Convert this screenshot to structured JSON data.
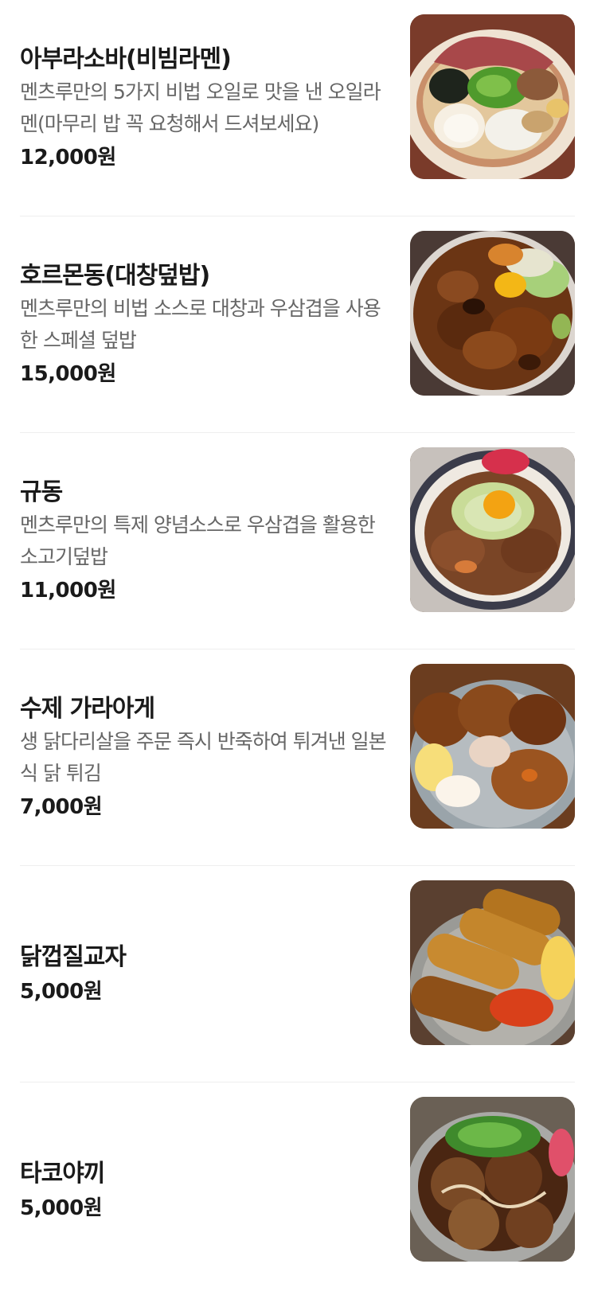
{
  "menu": {
    "items": [
      {
        "name": "아부라소바(비빔라멘)",
        "description": "멘츠루만의 5가지 비법 오일로 맛을 낸 오일라멘(마무리 밥 꼭 요청해서 드셔보세요)",
        "price": "12,000원",
        "photo_icon": "abura-soba-photo"
      },
      {
        "name": "호르몬동(대창덮밥)",
        "description": "멘츠루만의 비법 소스로 대창과 우삼겹을 사용한 스페셜 덮밥",
        "price": "15,000원",
        "photo_icon": "hormone-don-photo"
      },
      {
        "name": "규동",
        "description": "멘츠루만의 특제 양념소스로 우삼겹을 활용한 소고기덮밥",
        "price": "11,000원",
        "photo_icon": "gyudon-photo"
      },
      {
        "name": "수제 가라아게",
        "description": "생 닭다리살을 주문 즉시 반죽하여 튀겨낸 일본식 닭 튀김",
        "price": "7,000원",
        "photo_icon": "karaage-photo"
      },
      {
        "name": "닭껍질교자",
        "price": "5,000원",
        "photo_icon": "chicken-skin-gyoza-photo"
      },
      {
        "name": "타코야끼",
        "price": "5,000원",
        "photo_icon": "takoyaki-photo"
      }
    ]
  },
  "colors": {
    "title": "#1a1a1a",
    "description": "#666666",
    "price": "#1a1a1a",
    "divider": "#eeeeee"
  }
}
